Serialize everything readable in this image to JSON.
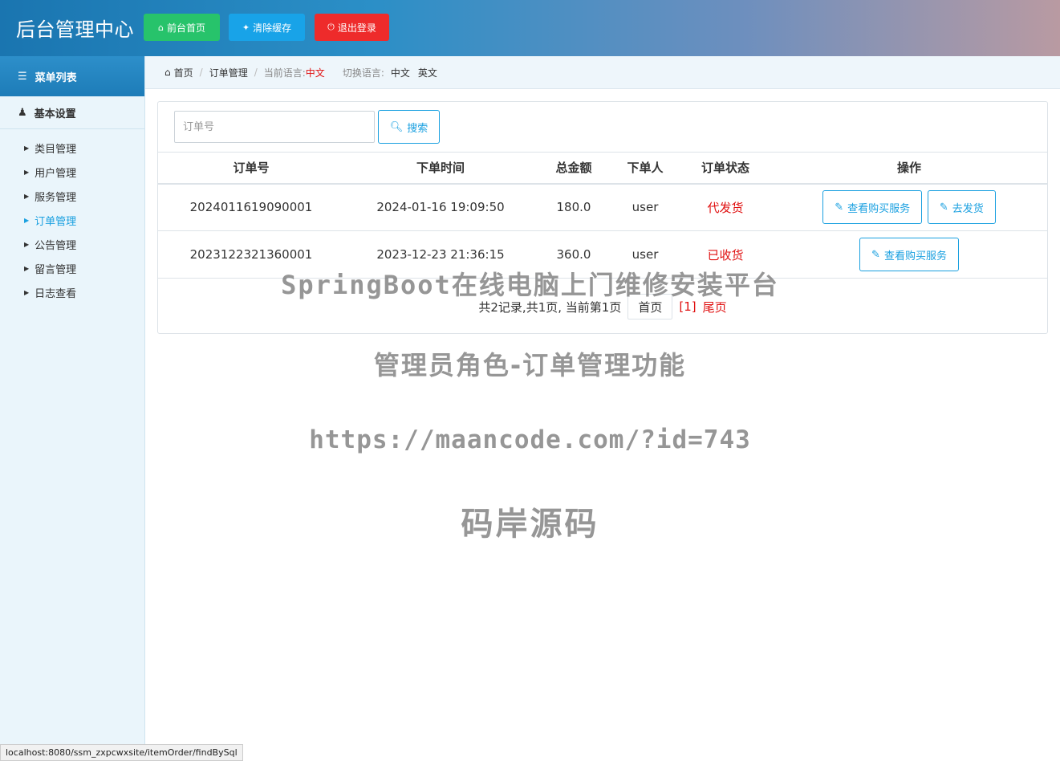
{
  "header": {
    "title": "后台管理中心",
    "buttons": {
      "home": "前台首页",
      "clear_cache": "清除缓存",
      "logout": "退出登录"
    }
  },
  "sidebar": {
    "menu_title": "菜单列表",
    "group_title": "基本设置",
    "items": [
      {
        "label": "类目管理"
      },
      {
        "label": "用户管理"
      },
      {
        "label": "服务管理"
      },
      {
        "label": "订单管理",
        "active": true
      },
      {
        "label": "公告管理"
      },
      {
        "label": "留言管理"
      },
      {
        "label": "日志查看"
      }
    ]
  },
  "breadcrumb": {
    "home": "首页",
    "current": "订单管理",
    "current_lang_label": "当前语言:",
    "current_lang": "中文",
    "switch_lang_label": "切换语言:",
    "lang_zh": "中文",
    "lang_en": "英文"
  },
  "search": {
    "placeholder": "订单号",
    "button": "搜索"
  },
  "table": {
    "headers": [
      "订单号",
      "下单时间",
      "总金额",
      "下单人",
      "订单状态",
      "操作"
    ],
    "rows": [
      {
        "order_no": "2024011619090001",
        "time": "2024-01-16 19:09:50",
        "amount": "180.0",
        "user": "user",
        "status": "代发货",
        "actions": [
          "查看购买服务",
          "去发货"
        ]
      },
      {
        "order_no": "2023122321360001",
        "time": "2023-12-23 21:36:15",
        "amount": "360.0",
        "user": "user",
        "status": "已收货",
        "actions": [
          "查看购买服务"
        ]
      }
    ]
  },
  "pager": {
    "summary": "共2记录,共1页, 当前第1页",
    "first": "首页",
    "page": "[1]",
    "last": "尾页"
  },
  "watermarks": [
    "SpringBoot在线电脑上门维修安装平台",
    "管理员角色-订单管理功能",
    "https://maancode.com/?id=743",
    "码岸源码"
  ],
  "status_url": "localhost:8080/ssm_zxpcwxsite/itemOrder/findBySql",
  "colors": {
    "accent": "#1aa0e0",
    "status_red": "#e01010",
    "btn_green": "#27c36b",
    "btn_blue": "#18a3e8",
    "btn_red": "#ee2b2b"
  },
  "icons": {
    "home": "home-icon",
    "clear_cache": "wrench-icon",
    "logout": "power-icon",
    "menu": "list-icon",
    "group": "user-icon",
    "search": "search-icon",
    "action": "edit-icon"
  }
}
